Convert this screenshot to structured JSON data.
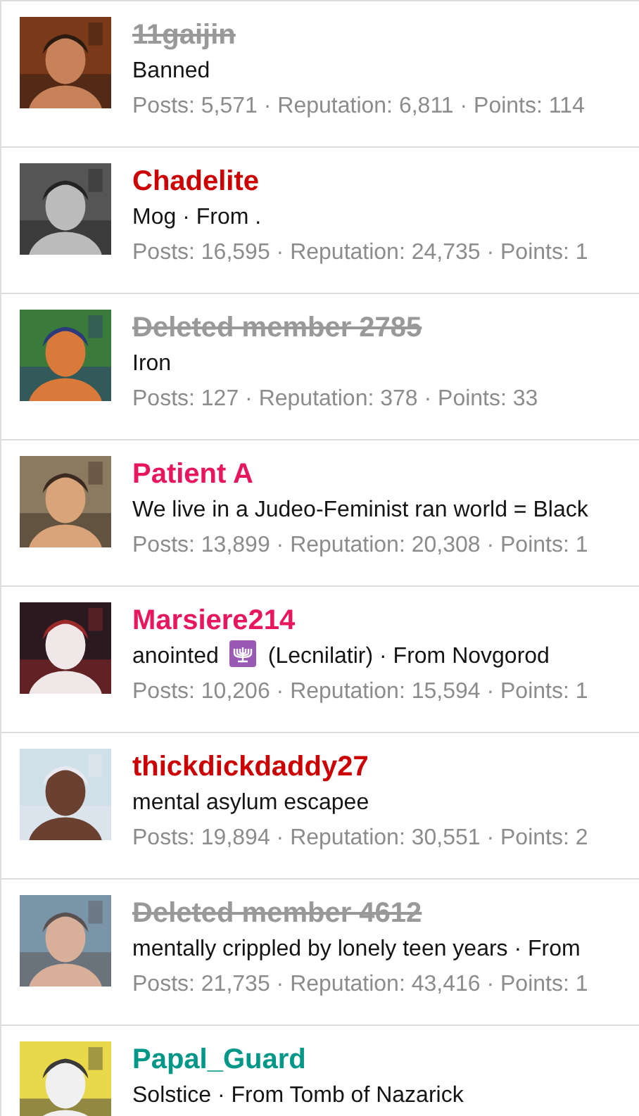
{
  "members": [
    {
      "name": "11gaijin",
      "struck": true,
      "color": "#999999",
      "blurb": [
        {
          "kind": "text",
          "text": "Banned"
        }
      ],
      "stats": "Posts: 5,571 · Reputation: 6,811 · Points: 114"
    },
    {
      "name": "Chadelite",
      "struck": false,
      "color": "#cc0000",
      "blurb": [
        {
          "kind": "text",
          "text": "Mog · From ."
        }
      ],
      "stats": "Posts: 16,595 · Reputation: 24,735 · Points: 1"
    },
    {
      "name": "Deleted member 2785",
      "struck": true,
      "color": "#999999",
      "blurb": [
        {
          "kind": "text",
          "text": "Iron"
        }
      ],
      "stats": "Posts: 127 · Reputation: 378 · Points: 33"
    },
    {
      "name": "Patient A",
      "struck": false,
      "color": "#e8175d",
      "blurb": [
        {
          "kind": "text",
          "text": "We live in a Judeo-Feminist ran world = Black"
        }
      ],
      "stats": "Posts: 13,899 · Reputation: 20,308 · Points: 1"
    },
    {
      "name": "Marsiere214",
      "struck": false,
      "color": "#e8175d",
      "blurb": [
        {
          "kind": "text",
          "text": "anointed"
        },
        {
          "kind": "icon"
        },
        {
          "kind": "text",
          "text": "(Lecnilatir) · From Novgorod"
        }
      ],
      "stats": "Posts: 10,206 · Reputation: 15,594 · Points: 1"
    },
    {
      "name": "thickdickdaddy27",
      "struck": false,
      "color": "#cc0000",
      "blurb": [
        {
          "kind": "text",
          "text": "mental asylum escapee"
        }
      ],
      "stats": "Posts: 19,894 · Reputation: 30,551 · Points: 2"
    },
    {
      "name": "Deleted member 4612",
      "struck": true,
      "color": "#999999",
      "blurb": [
        {
          "kind": "text",
          "text": "mentally crippled by lonely teen years · From"
        }
      ],
      "stats": "Posts: 21,735 · Reputation: 43,416 · Points: 1"
    },
    {
      "name": "Papal_Guard",
      "struck": false,
      "color": "#009688",
      "blurb": [
        {
          "kind": "text",
          "text": "Solstice · From Tomb of Nazarick"
        }
      ]
    }
  ]
}
